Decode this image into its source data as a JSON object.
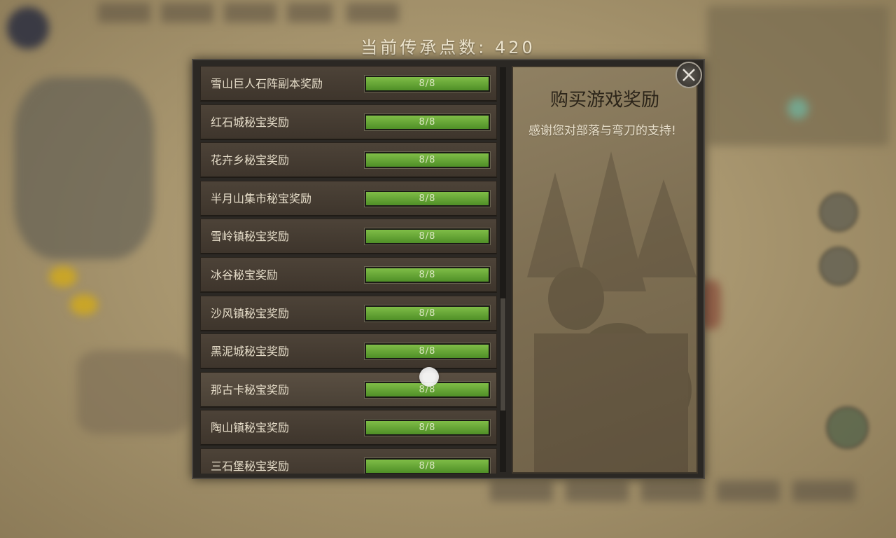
{
  "header": {
    "points_text": "当前传承点数: 420"
  },
  "rewards": [
    {
      "label": "雪山巨人石阵副本奖励",
      "progress": "8/8",
      "fraction": 1.0
    },
    {
      "label": "红石城秘宝奖励",
      "progress": "8/8",
      "fraction": 1.0
    },
    {
      "label": "花卉乡秘宝奖励",
      "progress": "8/8",
      "fraction": 1.0
    },
    {
      "label": "半月山集市秘宝奖励",
      "progress": "8/8",
      "fraction": 1.0
    },
    {
      "label": "雪岭镇秘宝奖励",
      "progress": "8/8",
      "fraction": 1.0
    },
    {
      "label": "冰谷秘宝奖励",
      "progress": "8/8",
      "fraction": 1.0
    },
    {
      "label": "沙风镇秘宝奖励",
      "progress": "8/8",
      "fraction": 1.0
    },
    {
      "label": "黑泥城秘宝奖励",
      "progress": "8/8",
      "fraction": 1.0
    },
    {
      "label": "那古卡秘宝奖励",
      "progress": "8/8",
      "fraction": 1.0
    },
    {
      "label": "陶山镇秘宝奖励",
      "progress": "8/8",
      "fraction": 1.0
    },
    {
      "label": "三石堡秘宝奖励",
      "progress": "8/8",
      "fraction": 1.0
    }
  ],
  "highlighted_index": 8,
  "detail": {
    "title": "购买游戏奖励",
    "description": "感谢您对部落与弯刀的支持!"
  },
  "icons": {
    "close": "close-icon",
    "touch": "touch-indicator-icon"
  },
  "colors": {
    "bar_fill": "#6aa93a",
    "panel_title": "#2b2419"
  }
}
